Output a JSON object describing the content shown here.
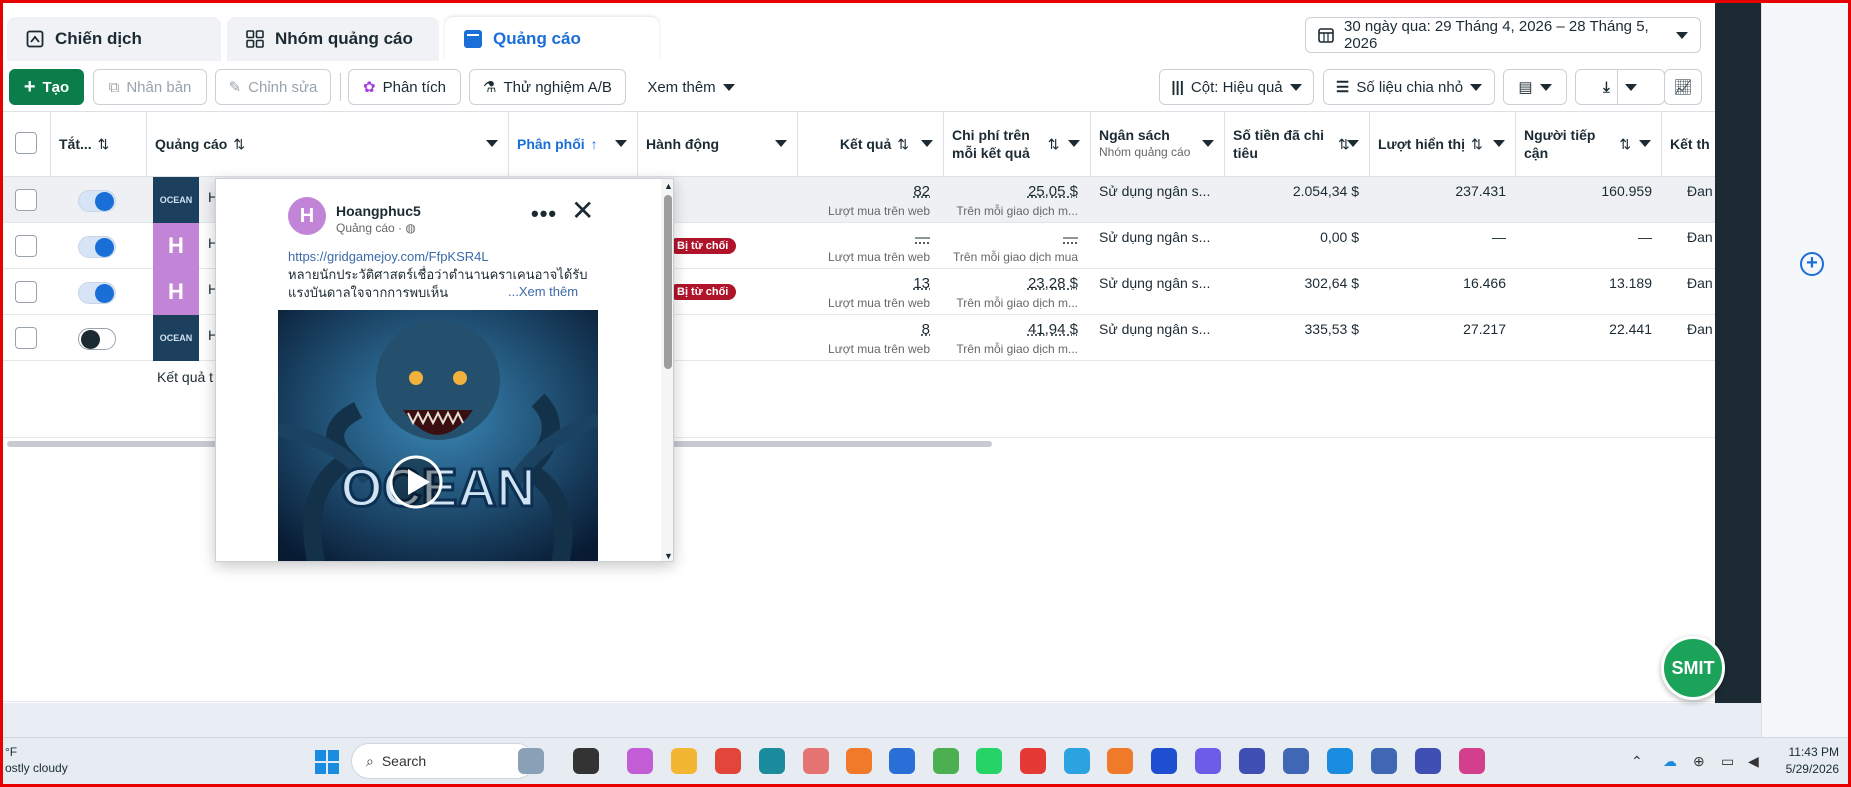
{
  "tabs": [
    {
      "label": "Chiến dịch",
      "icon": "campaign-icon"
    },
    {
      "label": "Nhóm quảng cáo",
      "icon": "grid-icon"
    },
    {
      "label": "Quảng cáo",
      "icon": "ad-icon"
    }
  ],
  "date_range": "30 ngày qua: 29 Tháng 4, 2026 – 28 Tháng 5, 2026",
  "toolbar": {
    "create": "Tạo",
    "duplicate": "Nhân bản",
    "edit": "Chỉnh sửa",
    "analyze": "Phân tích",
    "ab_test": "Thử nghiệm A/B",
    "more": "Xem thêm",
    "columns": "Cột: Hiệu quả",
    "breakdown": "Số liệu chia nhỏ"
  },
  "columns": {
    "onoff": "Tắt...",
    "ad": "Quảng cáo",
    "delivery": "Phân phối",
    "actions": "Hành động",
    "results": "Kết quả",
    "cpr_1": "Chi phí trên",
    "cpr_2": "mỗi kết quả",
    "budget": "Ngân sách",
    "budget_sub": "Nhóm quảng cáo",
    "spent_1": "Số tiền đã chi",
    "spent_2": "tiêu",
    "impressions": "Lượt hiển thị",
    "reach_1": "Người tiếp",
    "reach_2": "cận",
    "ends": "Kết th"
  },
  "rows": [
    {
      "toggle": "on",
      "thumb": "ocean",
      "name": "H",
      "badge": "",
      "results": "82",
      "results_sub": "Lượt mua trên web",
      "cpr": "25,05 $",
      "cpr_sub": "Trên mỗi giao dịch m...",
      "budget": "Sử dụng ngân s...",
      "spent": "2.054,34 $",
      "impressions": "237.431",
      "reach": "160.959",
      "end": "Đan"
    },
    {
      "toggle": "on",
      "thumb": "H",
      "name": "H",
      "badge": "Bị từ chối",
      "results": "—",
      "results_sub": "Lượt mua trên web",
      "cpr": "—",
      "cpr_sub": "Trên mỗi giao dịch mua",
      "budget": "Sử dụng ngân s...",
      "spent": "0,00 $",
      "impressions": "—",
      "reach": "—",
      "end": "Đan"
    },
    {
      "toggle": "on",
      "thumb": "H",
      "name": "H",
      "badge": "Bị từ chối",
      "results": "13",
      "results_sub": "Lượt mua trên web",
      "cpr": "23,28 $",
      "cpr_sub": "Trên mỗi giao dịch m...",
      "budget": "Sử dụng ngân s...",
      "spent": "302,64 $",
      "impressions": "16.466",
      "reach": "13.189",
      "end": "Đan"
    },
    {
      "toggle": "off",
      "thumb": "ocean",
      "name": "H",
      "badge": "",
      "results": "8",
      "results_sub": "Lượt mua trên web",
      "cpr": "41,94 $",
      "cpr_sub": "Trên mỗi giao dịch m...",
      "budget": "Sử dụng ngân s...",
      "spent": "335,53 $",
      "impressions": "27.217",
      "reach": "22.441",
      "end": "Đan"
    }
  ],
  "footer_note": "Kết quả t",
  "popup": {
    "avatar": "H",
    "page_name": "Hoangphuc5",
    "subtitle": "Quảng cáo · ",
    "link": "https://gridgamejoy.com/FfpKSR4L",
    "text": "หลายนักประวัติศาสตร์เชื่อว่าตำนานคราเคนอาจได้รับแรงบันดาลใจจากการพบเห็น",
    "see_more": "...Xem thêm",
    "image_title": "OCEAN"
  },
  "fab_label": "SMIT",
  "taskbar": {
    "weather_temp": "°F",
    "weather_desc": "ostly cloudy",
    "search": "Search",
    "time": "11:43 PM",
    "date": "5/29/2026"
  },
  "colors": {
    "accent": "#1a6ed8",
    "create_green": "#0a7d4b",
    "rejected": "#b0142a"
  }
}
